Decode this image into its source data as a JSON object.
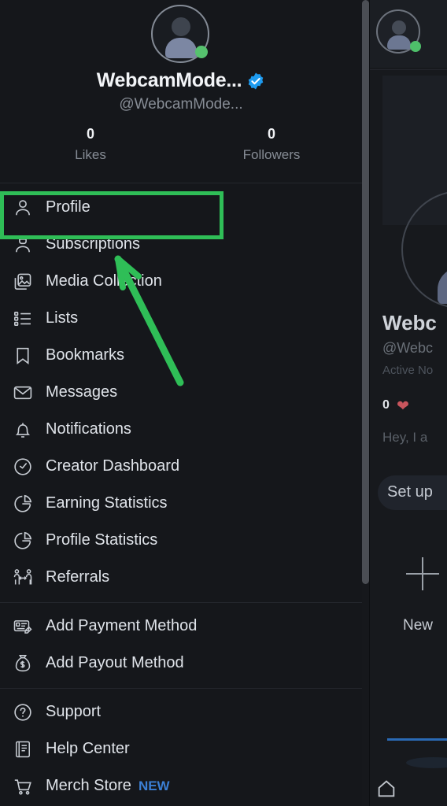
{
  "app": {
    "theme_bg": "#15171b",
    "accent_blue": "#3b7fd4",
    "online_color": "#56c26e",
    "annotation_color": "#2fbe57"
  },
  "profile": {
    "avatar_icon": "person-avatar-icon",
    "online_status_icon": "online-status-dot",
    "display_name": "WebcamMode...",
    "verified_icon": "verified-badge-icon",
    "handle": "@WebcamMode...",
    "stats": [
      {
        "value": "0",
        "label": "Likes"
      },
      {
        "value": "0",
        "label": "Followers"
      }
    ]
  },
  "menu": {
    "groups": [
      {
        "items": [
          {
            "label": "Profile",
            "icon": "person-icon",
            "highlighted": true
          },
          {
            "label": "Subscriptions",
            "icon": "subscriptions-person-icon"
          },
          {
            "label": "Media Collection",
            "icon": "image-stack-icon"
          },
          {
            "label": "Lists",
            "icon": "list-icon"
          },
          {
            "label": "Bookmarks",
            "icon": "bookmark-icon"
          },
          {
            "label": "Messages",
            "icon": "envelope-icon"
          },
          {
            "label": "Notifications",
            "icon": "bell-icon"
          },
          {
            "label": "Creator Dashboard",
            "icon": "dashboard-gauge-icon"
          },
          {
            "label": "Earning Statistics",
            "icon": "pie-chart-icon"
          },
          {
            "label": "Profile Statistics",
            "icon": "pie-chart-icon"
          },
          {
            "label": "Referrals",
            "icon": "referrals-people-icon"
          }
        ]
      },
      {
        "items": [
          {
            "label": "Add Payment Method",
            "icon": "payment-card-edit-icon"
          },
          {
            "label": "Add Payout Method",
            "icon": "money-bag-icon"
          }
        ]
      },
      {
        "items": [
          {
            "label": "Support",
            "icon": "question-circle-icon"
          },
          {
            "label": "Help Center",
            "icon": "book-icon"
          },
          {
            "label": "Merch Store",
            "icon": "shopping-cart-icon",
            "badge": "NEW"
          }
        ]
      }
    ]
  },
  "annotation": {
    "highlight_target": "Profile",
    "arrow_icon": "green-pointer-arrow"
  },
  "background_app": {
    "display_name": "Webc",
    "handle": "@Webc",
    "active_status": "Active No",
    "likes_count": "0",
    "heart_icon": "heart-icon",
    "bio_text": "Hey, I a",
    "setup_button": "Set up",
    "new_post_label": "New",
    "plus_icon": "plus-icon",
    "home_icon": "home-icon"
  },
  "scrollbar": {
    "name": "vertical-scrollbar"
  }
}
